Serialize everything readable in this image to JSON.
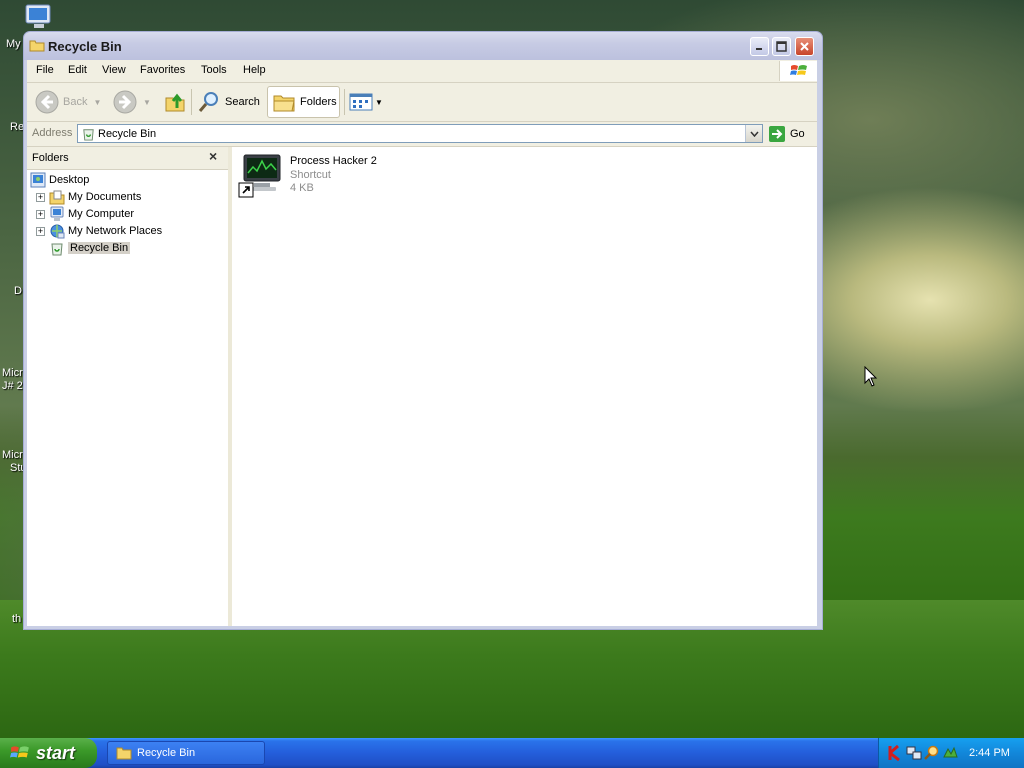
{
  "window": {
    "title": "Recycle Bin",
    "menu": [
      "File",
      "Edit",
      "View",
      "Favorites",
      "Tools",
      "Help"
    ],
    "toolbar": {
      "back_label": "Back",
      "search_label": "Search",
      "folders_label": "Folders"
    },
    "address": {
      "label": "Address",
      "value": "Recycle Bin",
      "go_label": "Go"
    },
    "folders_pane": {
      "title": "Folders",
      "close_glyph": "×",
      "items": [
        {
          "label": "Desktop",
          "icon": "desktop-icon"
        },
        {
          "label": "My Documents",
          "icon": "my-documents-icon",
          "expander": "+"
        },
        {
          "label": "My Computer",
          "icon": "my-computer-icon",
          "expander": "+"
        },
        {
          "label": "My Network Places",
          "icon": "network-places-icon",
          "expander": "+"
        },
        {
          "label": "Recycle Bin",
          "icon": "recycle-bin-icon",
          "selected": true
        }
      ]
    },
    "files": [
      {
        "name": "Process Hacker 2",
        "type": "Shortcut",
        "size": "4 KB",
        "icon": "process-hacker-icon"
      }
    ]
  },
  "desktop": {
    "partial_labels": [
      "My",
      "Re",
      "D",
      "Micro",
      "J# 2",
      "Micro",
      "Stu",
      "th"
    ]
  },
  "taskbar": {
    "start_label": "start",
    "tasks": [
      {
        "label": "Recycle Bin",
        "icon": "folder-icon"
      }
    ],
    "tray_icons": [
      "kaspersky-icon",
      "network-icon",
      "search-tray-icon",
      "security-tray-icon"
    ],
    "clock": "2:44 PM"
  }
}
